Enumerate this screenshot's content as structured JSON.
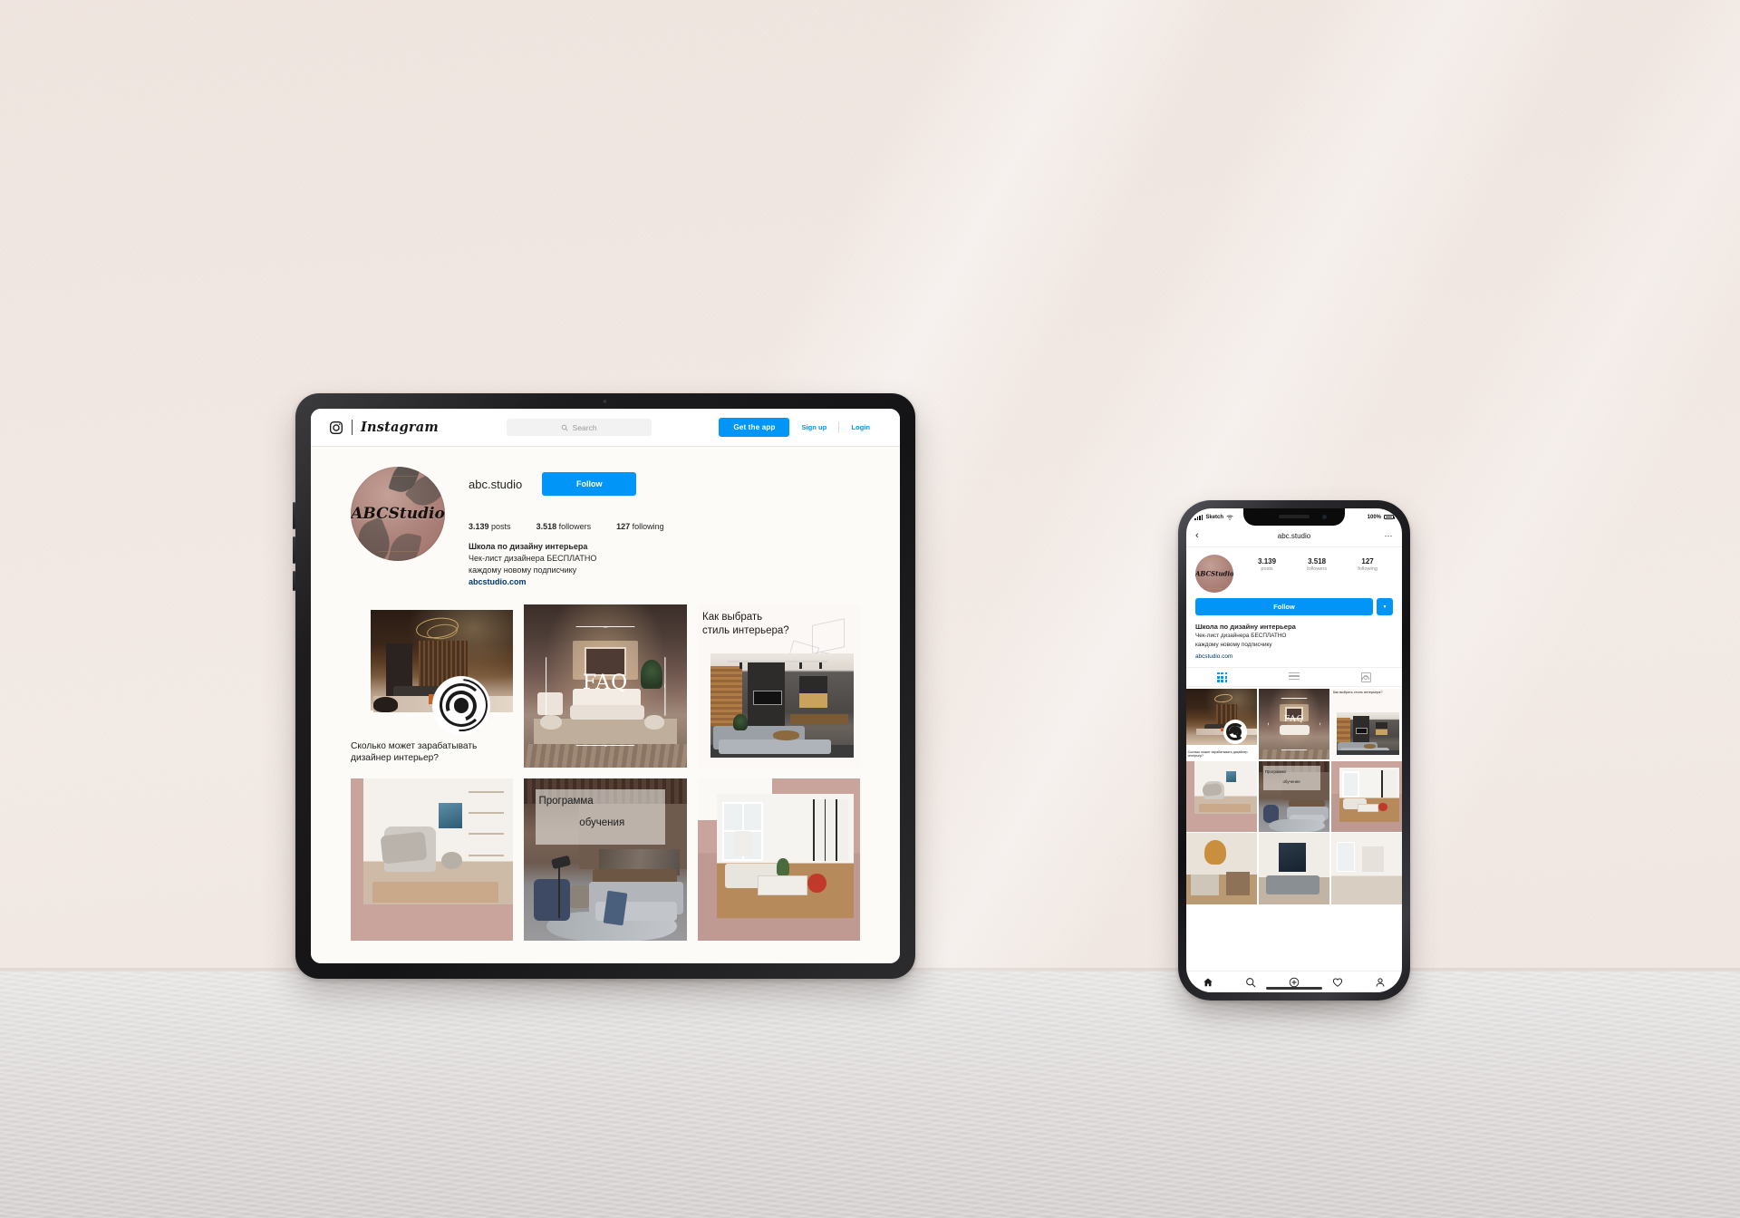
{
  "scene": {
    "description": "Instagram profile mockup on tablet and phone",
    "wall_color": "#f0e5df",
    "table_color": "#ddd9d8"
  },
  "tablet": {
    "header": {
      "logo_icon": "instagram-camera-icon",
      "wordmark": "Instagram",
      "search_placeholder": "Search",
      "search_icon": "search-icon",
      "get_app_label": "Get the app",
      "signup_label": "Sign up",
      "login_label": "Login"
    },
    "profile": {
      "avatar_text": "ABCStudio",
      "username": "abc.studio",
      "follow_label": "Follow",
      "stats": [
        {
          "value": "3.139",
          "label": "posts"
        },
        {
          "value": "3.518",
          "label": "followers"
        },
        {
          "value": "127",
          "label": "following"
        }
      ],
      "bio_title": "Школа по дизайну интерьера",
      "bio_line1": "Чек-лист дизайнера БЕСПЛАТНО",
      "bio_line2": "каждому новому подписчику",
      "bio_link": "abcstudio.com"
    },
    "grid": [
      {
        "id": "post-earnings",
        "caption": "Сколько может зарабатывать дизайнер интерьер?"
      },
      {
        "id": "post-faq",
        "overlay": "FAQ"
      },
      {
        "id": "post-style",
        "title": "Как выбрать\nстиль интерьера?"
      },
      {
        "id": "post-bedroom",
        "caption": ""
      },
      {
        "id": "post-program",
        "line1": "Программа",
        "line2": "обучения"
      },
      {
        "id": "post-livingroom",
        "caption": ""
      }
    ]
  },
  "phone": {
    "status": {
      "carrier": "Sketch",
      "battery": "100%"
    },
    "nav": {
      "back_icon": "chevron-left-icon",
      "title": "abc.studio",
      "more_icon": "more-dots-icon"
    },
    "profile": {
      "avatar_text": "ABCStudio",
      "follow_label": "Follow",
      "caret_icon": "chevron-down-icon",
      "stats": [
        {
          "value": "3.139",
          "label": "posts"
        },
        {
          "value": "3.518",
          "label": "followers"
        },
        {
          "value": "127",
          "label": "following"
        }
      ],
      "bio_title": "Школа по дизайну интерьера",
      "bio_line1": "Чек-лист дизайнера БЕСПЛАТНО",
      "bio_line2": "каждому новому подписчику",
      "bio_link": "abcstudio.com"
    },
    "tabs": [
      {
        "id": "tab-grid",
        "icon": "grid-icon",
        "active": true
      },
      {
        "id": "tab-list",
        "icon": "list-icon",
        "active": false
      },
      {
        "id": "tab-tagged",
        "icon": "tagged-icon",
        "active": false
      }
    ],
    "grid": [
      {
        "id": "p-post-earnings",
        "caption": "Сколько может зарабатывать дизайнер интерьер?"
      },
      {
        "id": "p-post-faq",
        "overlay": "FAQ"
      },
      {
        "id": "p-post-style",
        "title": "Как выбрать стиль интерьера?"
      },
      {
        "id": "p-post-bedroom",
        "caption": ""
      },
      {
        "id": "p-post-program",
        "line1": "Программа",
        "line2": "обучения"
      },
      {
        "id": "p-post-livingroom",
        "caption": ""
      },
      {
        "id": "p-post-extra1",
        "caption": ""
      },
      {
        "id": "p-post-extra2",
        "caption": ""
      },
      {
        "id": "p-post-extra3",
        "caption": ""
      }
    ],
    "bottom_nav": [
      {
        "id": "nav-home",
        "icon": "home-icon"
      },
      {
        "id": "nav-search",
        "icon": "search-icon"
      },
      {
        "id": "nav-add",
        "icon": "plus-circle-icon"
      },
      {
        "id": "nav-activity",
        "icon": "heart-icon"
      },
      {
        "id": "nav-profile",
        "icon": "person-icon"
      }
    ]
  },
  "colors": {
    "accent": "#0095f6",
    "link": "#00376b",
    "text": "#262626",
    "muted": "#8e8e8e",
    "rose": "#c8a49c"
  }
}
